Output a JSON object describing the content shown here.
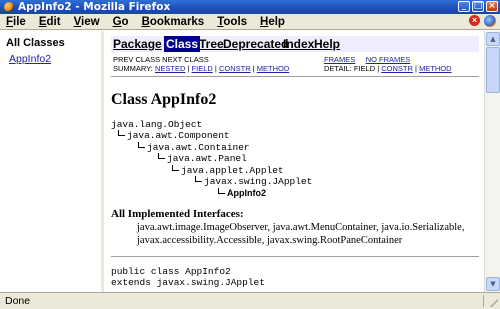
{
  "window": {
    "title": "AppInfo2 - Mozilla Firefox"
  },
  "menubar": {
    "items": [
      {
        "label": "File",
        "accel": "F",
        "rest": "ile"
      },
      {
        "label": "Edit",
        "accel": "E",
        "rest": "dit"
      },
      {
        "label": "View",
        "accel": "V",
        "rest": "iew"
      },
      {
        "label": "Go",
        "accel": "G",
        "rest": "o"
      },
      {
        "label": "Bookmarks",
        "accel": "B",
        "rest": "ookmarks"
      },
      {
        "label": "Tools",
        "accel": "T",
        "rest": "ools"
      },
      {
        "label": "Help",
        "accel": "H",
        "rest": "elp"
      }
    ]
  },
  "left_frame": {
    "heading": "All Classes",
    "links": [
      "AppInfo2"
    ]
  },
  "javadoc": {
    "nav": {
      "package": "Package",
      "class": "Class",
      "tree": "Tree",
      "deprecated": "Deprecated",
      "index": "Index",
      "help": "Help"
    },
    "prev_next": "PREV CLASS   NEXT CLASS",
    "frames": "FRAMES",
    "no_frames": "NO FRAMES",
    "summary_label": "SUMMARY:",
    "summary_nested": "NESTED",
    "summary_field": "FIELD",
    "summary_constr": "CONSTR",
    "summary_method": "METHOD",
    "detail_label": "DETAIL: FIELD |",
    "detail_constr": "CONSTR",
    "detail_method": "METHOD",
    "sep": "|",
    "class_title": "Class AppInfo2",
    "tree": [
      "java.lang.Object",
      "java.awt.Component",
      "java.awt.Container",
      "java.awt.Panel",
      "java.applet.Applet",
      "javax.swing.JApplet",
      "AppInfo2"
    ],
    "interfaces_heading": "All Implemented Interfaces:",
    "interfaces": "java.awt.image.ImageObserver, java.awt.MenuContainer, java.io.Serializable, javax.accessibility.Accessible, javax.swing.RootPaneContainer",
    "decl_line1": "public class AppInfo2",
    "decl_line2": "extends javax.swing.JApplet"
  },
  "status": {
    "text": "Done"
  }
}
